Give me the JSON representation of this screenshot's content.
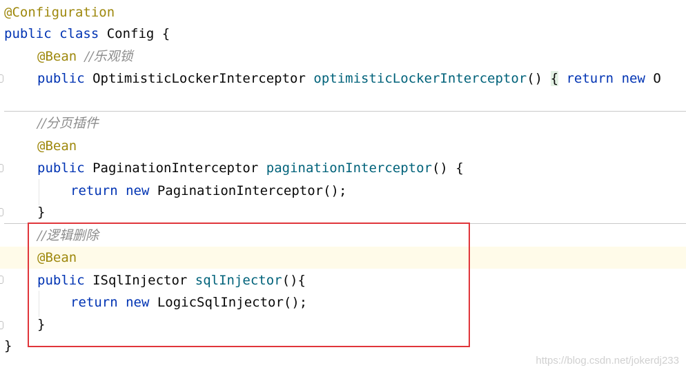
{
  "lines": [
    {
      "id": "l1",
      "tokens": [
        {
          "t": "@Configuration",
          "c": "ann"
        }
      ]
    },
    {
      "id": "l2",
      "tokens": [
        {
          "t": "public",
          "c": "kw"
        },
        {
          "t": " "
        },
        {
          "t": "class",
          "c": "kw"
        },
        {
          "t": " Config {",
          "c": "plain"
        }
      ]
    },
    {
      "id": "l3",
      "tokens": [
        {
          "t": "@Bean",
          "c": "ann"
        },
        {
          "t": " "
        },
        {
          "t": "//",
          "c": "cm-slash"
        },
        {
          "t": "乐观锁",
          "c": "cm"
        }
      ]
    },
    {
      "id": "l4",
      "tokens": [
        {
          "t": "public",
          "c": "kw"
        },
        {
          "t": " OptimisticLockerInterceptor ",
          "c": "plain"
        },
        {
          "t": "optimisticLockerInterceptor",
          "c": "fn"
        },
        {
          "t": "() ",
          "c": "plain"
        },
        {
          "t": "{",
          "c": "brace"
        },
        {
          "t": " "
        },
        {
          "t": "return",
          "c": "kw"
        },
        {
          "t": " "
        },
        {
          "t": "new",
          "c": "kw"
        },
        {
          "t": " O",
          "c": "plain"
        }
      ]
    },
    {
      "id": "l5",
      "tokens": []
    },
    {
      "id": "l6",
      "tokens": [
        {
          "t": "//",
          "c": "cm-slash"
        },
        {
          "t": "分页插件",
          "c": "cm"
        }
      ]
    },
    {
      "id": "l7",
      "tokens": [
        {
          "t": "@Bean",
          "c": "ann"
        }
      ]
    },
    {
      "id": "l8",
      "tokens": [
        {
          "t": "public",
          "c": "kw"
        },
        {
          "t": " PaginationInterceptor ",
          "c": "plain"
        },
        {
          "t": "paginationInterceptor",
          "c": "fn"
        },
        {
          "t": "() {",
          "c": "plain"
        }
      ]
    },
    {
      "id": "l9",
      "tokens": [
        {
          "t": "return",
          "c": "kw"
        },
        {
          "t": " "
        },
        {
          "t": "new",
          "c": "kw"
        },
        {
          "t": " PaginationInterceptor();",
          "c": "plain"
        }
      ]
    },
    {
      "id": "l10",
      "tokens": [
        {
          "t": "}",
          "c": "plain"
        }
      ]
    },
    {
      "id": "l11",
      "tokens": [
        {
          "t": "//",
          "c": "cm-slash"
        },
        {
          "t": "逻辑删除",
          "c": "cm"
        }
      ]
    },
    {
      "id": "l12",
      "tokens": [
        {
          "t": "@Bean",
          "c": "ann"
        }
      ]
    },
    {
      "id": "l13",
      "tokens": [
        {
          "t": "public",
          "c": "kw"
        },
        {
          "t": " ISqlInjector ",
          "c": "plain"
        },
        {
          "t": "sqlInjector",
          "c": "fn"
        },
        {
          "t": "(){",
          "c": "plain"
        }
      ]
    },
    {
      "id": "l14",
      "tokens": [
        {
          "t": "return",
          "c": "kw"
        },
        {
          "t": " "
        },
        {
          "t": "new",
          "c": "kw"
        },
        {
          "t": " LogicSqlInjector();",
          "c": "plain"
        }
      ]
    },
    {
      "id": "l15",
      "tokens": [
        {
          "t": "}",
          "c": "plain"
        }
      ]
    },
    {
      "id": "l16",
      "tokens": [
        {
          "t": "}",
          "c": "plain"
        }
      ]
    }
  ],
  "watermark": "https://blog.csdn.net/jokerdj233"
}
